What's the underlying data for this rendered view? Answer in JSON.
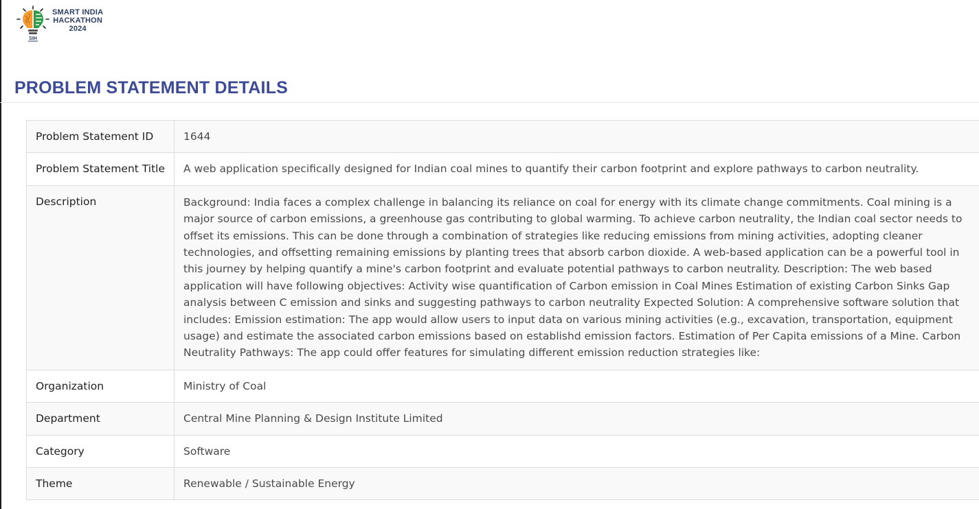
{
  "logo": {
    "line1": "SMART INDIA",
    "line2": "HACKATHON",
    "line3": "2024",
    "badge": "SIH"
  },
  "page": {
    "title": "PROBLEM STATEMENT DETAILS"
  },
  "details": {
    "id_label": "Problem Statement ID",
    "id_value": "1644",
    "title_label": "Problem Statement Title",
    "title_value": "A web application specifically designed for Indian coal mines to quantify their carbon footprint and explore pathways to carbon neutrality.",
    "description_label": "Description",
    "description_value": "Background: India faces a complex challenge in balancing its reliance on coal for energy with its climate change commitments. Coal mining is a major source of carbon emissions, a greenhouse gas contributing to global warming. To achieve carbon neutrality, the Indian coal sector needs to offset its emissions. This can be done through a combination of strategies like reducing emissions from mining activities, adopting cleaner technologies, and offsetting remaining emissions by planting trees that absorb carbon dioxide. A web-based application can be a powerful tool in this journey by helping quantify a mine's carbon footprint and evaluate potential pathways to carbon neutrality. Description: The web based application will have following objectives: Activity wise quantification of Carbon emission in Coal Mines Estimation of existing Carbon Sinks Gap analysis between C emission and sinks and suggesting pathways to carbon neutrality Expected Solution: A comprehensive software solution that includes: Emission estimation: The app would allow users to input data on various mining activities (e.g., excavation, transportation, equipment usage) and estimate the associated carbon emissions based on establishd emission factors. Estimation of Per Capita emissions of a Mine. Carbon Neutrality Pathways: The app could offer features for simulating different emission reduction strategies like:",
    "organization_label": "Organization",
    "organization_value": "Ministry of Coal",
    "department_label": "Department",
    "department_value": "Central Mine Planning & Design Institute Limited",
    "category_label": "Category",
    "category_value": "Software",
    "theme_label": "Theme",
    "theme_value": "Renewable / Sustainable Energy"
  },
  "colors": {
    "title": "#3c4a96",
    "logo_orange": "#f39c34",
    "logo_green": "#2e9b4a",
    "border": "#dcdcdc",
    "stripe": "#f9f9f9"
  }
}
